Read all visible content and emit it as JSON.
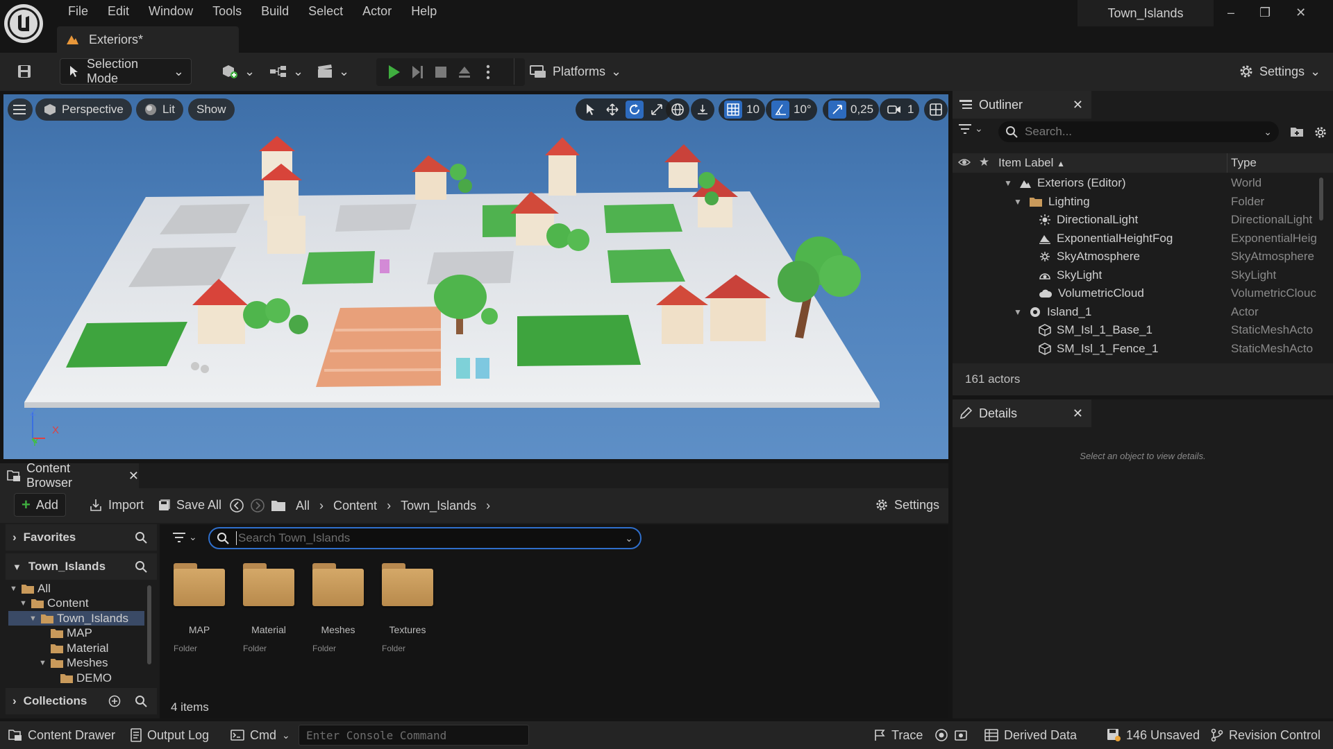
{
  "titlebar": {
    "menu": [
      "File",
      "Edit",
      "Window",
      "Tools",
      "Build",
      "Select",
      "Actor",
      "Help"
    ],
    "level_tab": "Exteriors*",
    "project_name": "Town_Islands"
  },
  "toolbar": {
    "selection_mode": "Selection Mode",
    "platforms": "Platforms",
    "settings": "Settings"
  },
  "viewport": {
    "perspective": "Perspective",
    "lit": "Lit",
    "show": "Show",
    "grid_snap": "10",
    "rotation_snap": "10°",
    "scale_snap": "0,25",
    "camera_speed": "1",
    "axis_z": "Z",
    "axis_x": "X",
    "axis_y": "Y"
  },
  "outliner": {
    "title": "Outliner",
    "search_placeholder": "Search...",
    "col_label": "Item Label",
    "col_type": "Type",
    "rows": [
      {
        "name": "Exteriors (Editor)",
        "type": "World",
        "indent": 0,
        "arrow": "open",
        "icon": "world-icon"
      },
      {
        "name": "Lighting",
        "type": "Folder",
        "indent": 1,
        "arrow": "open",
        "icon": "folder-icon"
      },
      {
        "name": "DirectionalLight",
        "type": "DirectionalLight",
        "indent": 2,
        "arrow": "",
        "icon": "sun-icon"
      },
      {
        "name": "ExponentialHeightFog",
        "type": "ExponentialHeig",
        "indent": 2,
        "arrow": "",
        "icon": "fog-icon"
      },
      {
        "name": "SkyAtmosphere",
        "type": "SkyAtmosphere",
        "indent": 2,
        "arrow": "",
        "icon": "atmosphere-icon"
      },
      {
        "name": "SkyLight",
        "type": "SkyLight",
        "indent": 2,
        "arrow": "",
        "icon": "skylight-icon"
      },
      {
        "name": "VolumetricCloud",
        "type": "VolumetricClouc",
        "indent": 2,
        "arrow": "",
        "icon": "cloud-icon"
      },
      {
        "name": "Island_1",
        "type": "Actor",
        "indent": 1,
        "arrow": "open",
        "icon": "actor-icon"
      },
      {
        "name": "SM_Isl_1_Base_1",
        "type": "StaticMeshActo",
        "indent": 2,
        "arrow": "",
        "icon": "mesh-icon"
      },
      {
        "name": "SM_Isl_1_Fence_1",
        "type": "StaticMeshActo",
        "indent": 2,
        "arrow": "",
        "icon": "mesh-icon"
      }
    ],
    "actor_count": "161 actors"
  },
  "details": {
    "title": "Details",
    "empty_message": "Select an object to view details."
  },
  "content_browser": {
    "title": "Content Browser",
    "add": "Add",
    "import": "Import",
    "save_all": "Save All",
    "breadcrumb": [
      "All",
      "Content",
      "Town_Islands"
    ],
    "settings": "Settings",
    "favorites": "Favorites",
    "root_section": "Town_Islands",
    "search_placeholder": "Search Town_Islands",
    "tree": [
      {
        "label": "All",
        "indent": 0,
        "arrow": "open"
      },
      {
        "label": "Content",
        "indent": 1,
        "arrow": "open"
      },
      {
        "label": "Town_Islands",
        "indent": 2,
        "arrow": "open",
        "selected": true
      },
      {
        "label": "MAP",
        "indent": 3,
        "arrow": ""
      },
      {
        "label": "Material",
        "indent": 3,
        "arrow": ""
      },
      {
        "label": "Meshes",
        "indent": 3,
        "arrow": "open"
      },
      {
        "label": "DEMO",
        "indent": 4,
        "arrow": ""
      }
    ],
    "collections": "Collections",
    "assets": [
      {
        "name": "MAP",
        "kind": "Folder"
      },
      {
        "name": "Material",
        "kind": "Folder"
      },
      {
        "name": "Meshes",
        "kind": "Folder"
      },
      {
        "name": "Textures",
        "kind": "Folder"
      }
    ],
    "item_count": "4 items"
  },
  "statusbar": {
    "content_drawer": "Content Drawer",
    "output_log": "Output Log",
    "cmd": "Cmd",
    "console_placeholder": "Enter Console Command",
    "trace": "Trace",
    "derived_data": "Derived Data",
    "unsaved": "146 Unsaved",
    "revision_control": "Revision Control"
  },
  "colors": {
    "accent": "#2d6bbf",
    "play_green": "#3fae3f",
    "folder": "#c99a5b"
  }
}
